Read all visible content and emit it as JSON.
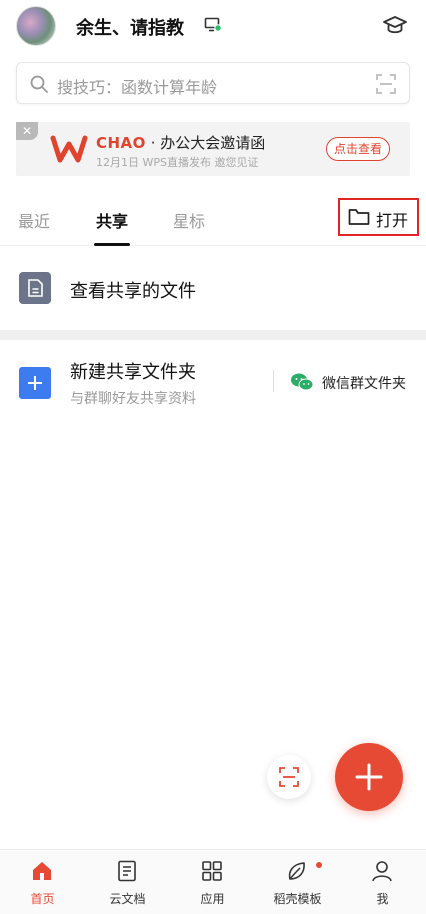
{
  "header": {
    "username": "余生、请指教",
    "avatar_icon": "avatar",
    "device_icon": "monitor-online-icon",
    "profile_icon": "graduation-cap-icon"
  },
  "search": {
    "placeholder": "搜技巧：函数计算年龄",
    "icon": "search-icon",
    "scan_icon": "scan-icon"
  },
  "banner": {
    "close_label": "✕",
    "brand": "CHAO",
    "title": " · 办公大会邀请函",
    "subtitle": "12月1日 WPS直播发布 邀您见证",
    "button_label": "点击查看"
  },
  "tabs": [
    {
      "label": "最近"
    },
    {
      "label": "共享"
    },
    {
      "label": "星标"
    }
  ],
  "active_tab": "共享",
  "open_button": {
    "label": "打开"
  },
  "shared": {
    "view_label": "查看共享的文件",
    "new_title": "新建共享文件夹",
    "new_subtitle": "与群聊好友共享资料",
    "wechat_label": "微信群文件夹"
  },
  "bottom_nav": [
    {
      "label": "首页",
      "icon": "home-icon"
    },
    {
      "label": "云文档",
      "icon": "document-icon"
    },
    {
      "label": "应用",
      "icon": "apps-grid-icon"
    },
    {
      "label": "稻壳模板",
      "icon": "leaf-icon"
    },
    {
      "label": "我",
      "icon": "user-icon"
    }
  ],
  "colors": {
    "accent": "#e74a34",
    "highlight_box": "#e12424",
    "blue": "#3c7cf0",
    "wechat_green": "#2aae67"
  }
}
